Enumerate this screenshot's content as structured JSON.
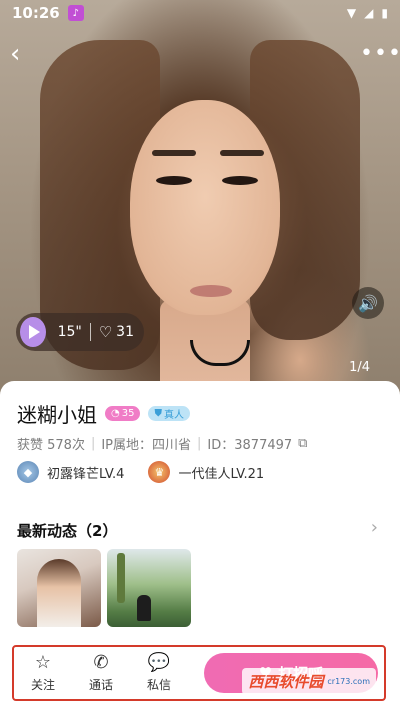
{
  "status_bar": {
    "time": "10:26"
  },
  "hero": {
    "voice_duration": "15\"",
    "like_count": "31",
    "page_indicator": "1/4"
  },
  "profile": {
    "name": "迷糊小姐",
    "level_badge": "35",
    "verified_badge": "真人",
    "likes": "获赞 578次",
    "ip_location": "IP属地：四川省",
    "id": "ID：3877497",
    "honors": [
      {
        "label": "初露锋芒LV.4"
      },
      {
        "label": "一代佳人LV.21"
      }
    ]
  },
  "moments": {
    "title": "最新动态（2）"
  },
  "bottom_bar": {
    "follow": "关注",
    "call": "通话",
    "message": "私信",
    "call_button": "打招呼"
  },
  "watermark": {
    "main": "西西软件园",
    "sub": "cr173.com"
  },
  "colors": {
    "accent": "#f06bb3",
    "highlight_box": "#d43a2a"
  }
}
